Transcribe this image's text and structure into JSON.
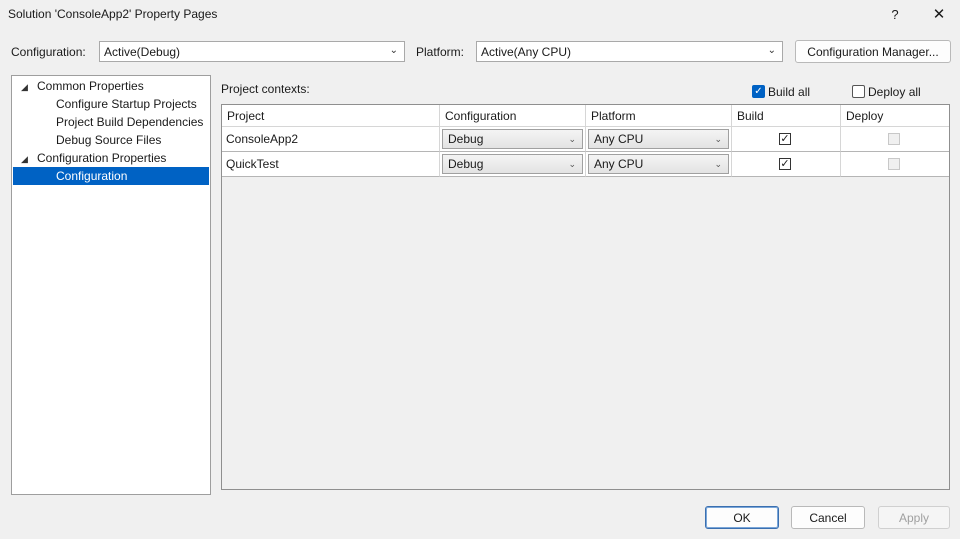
{
  "window": {
    "title": "Solution 'ConsoleApp2' Property Pages",
    "help": "?",
    "close": "✕"
  },
  "toolbar": {
    "configuration_label": "Configuration:",
    "configuration_value": "Active(Debug)",
    "platform_label": "Platform:",
    "platform_value": "Active(Any CPU)",
    "config_manager_label": "Configuration Manager..."
  },
  "tree": {
    "groups": [
      {
        "label": "Common Properties",
        "expanded": true,
        "items": [
          "Configure Startup Projects",
          "Project Build Dependencies",
          "Debug Source Files"
        ]
      },
      {
        "label": "Configuration Properties",
        "expanded": true,
        "items": [
          "Configuration"
        ]
      }
    ],
    "selected": "Configuration"
  },
  "contexts": {
    "label": "Project contexts:",
    "build_all_label": "Build all",
    "build_all_checked": true,
    "deploy_all_label": "Deploy all",
    "deploy_all_checked": false,
    "columns": [
      "Project",
      "Configuration",
      "Platform",
      "Build",
      "Deploy"
    ],
    "rows": [
      {
        "project": "ConsoleApp2",
        "configuration": "Debug",
        "platform": "Any CPU",
        "build": true,
        "deploy": false
      },
      {
        "project": "QuickTest",
        "configuration": "Debug",
        "platform": "Any CPU",
        "build": true,
        "deploy": false
      }
    ]
  },
  "buttons": {
    "ok": "OK",
    "cancel": "Cancel",
    "apply": "Apply"
  },
  "colors": {
    "accent": "#0062c4",
    "background": "#f0f0f0"
  }
}
